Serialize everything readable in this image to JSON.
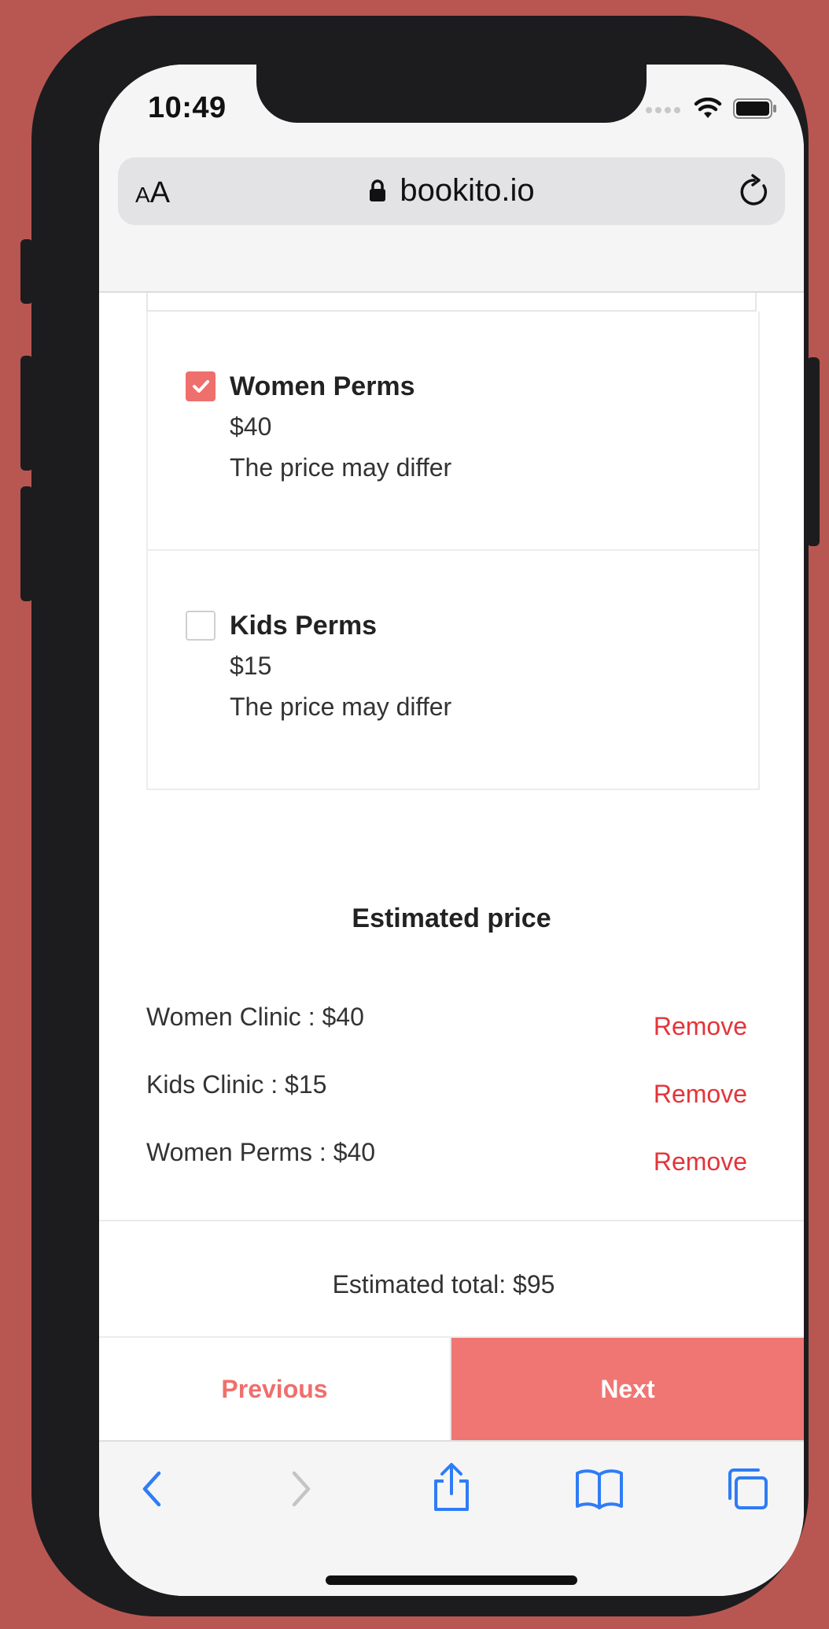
{
  "status_bar": {
    "time": "10:49"
  },
  "browser": {
    "text_size_small": "A",
    "text_size_large": "A",
    "url": "bookito.io"
  },
  "services": [
    {
      "name": "Women Perms",
      "price": "$40",
      "note": "The price may differ",
      "checked": true
    },
    {
      "name": "Kids Perms",
      "price": "$15",
      "note": "The price may differ",
      "checked": false
    }
  ],
  "estimate": {
    "title": "Estimated price",
    "items": [
      {
        "label": "Women Clinic : $40",
        "action": "Remove"
      },
      {
        "label": "Kids Clinic : $15",
        "action": "Remove"
      },
      {
        "label": "Women Perms : $40",
        "action": "Remove"
      }
    ],
    "total": "Estimated total: $95"
  },
  "nav": {
    "previous": "Previous",
    "next": "Next"
  },
  "colors": {
    "accent": "#ef7673",
    "remove": "#e3343a",
    "background": "#b85752",
    "safari_blue": "#2f7cf6"
  },
  "toolbar_icons": [
    "back-icon",
    "forward-icon",
    "share-icon",
    "bookmarks-icon",
    "tabs-icon"
  ]
}
